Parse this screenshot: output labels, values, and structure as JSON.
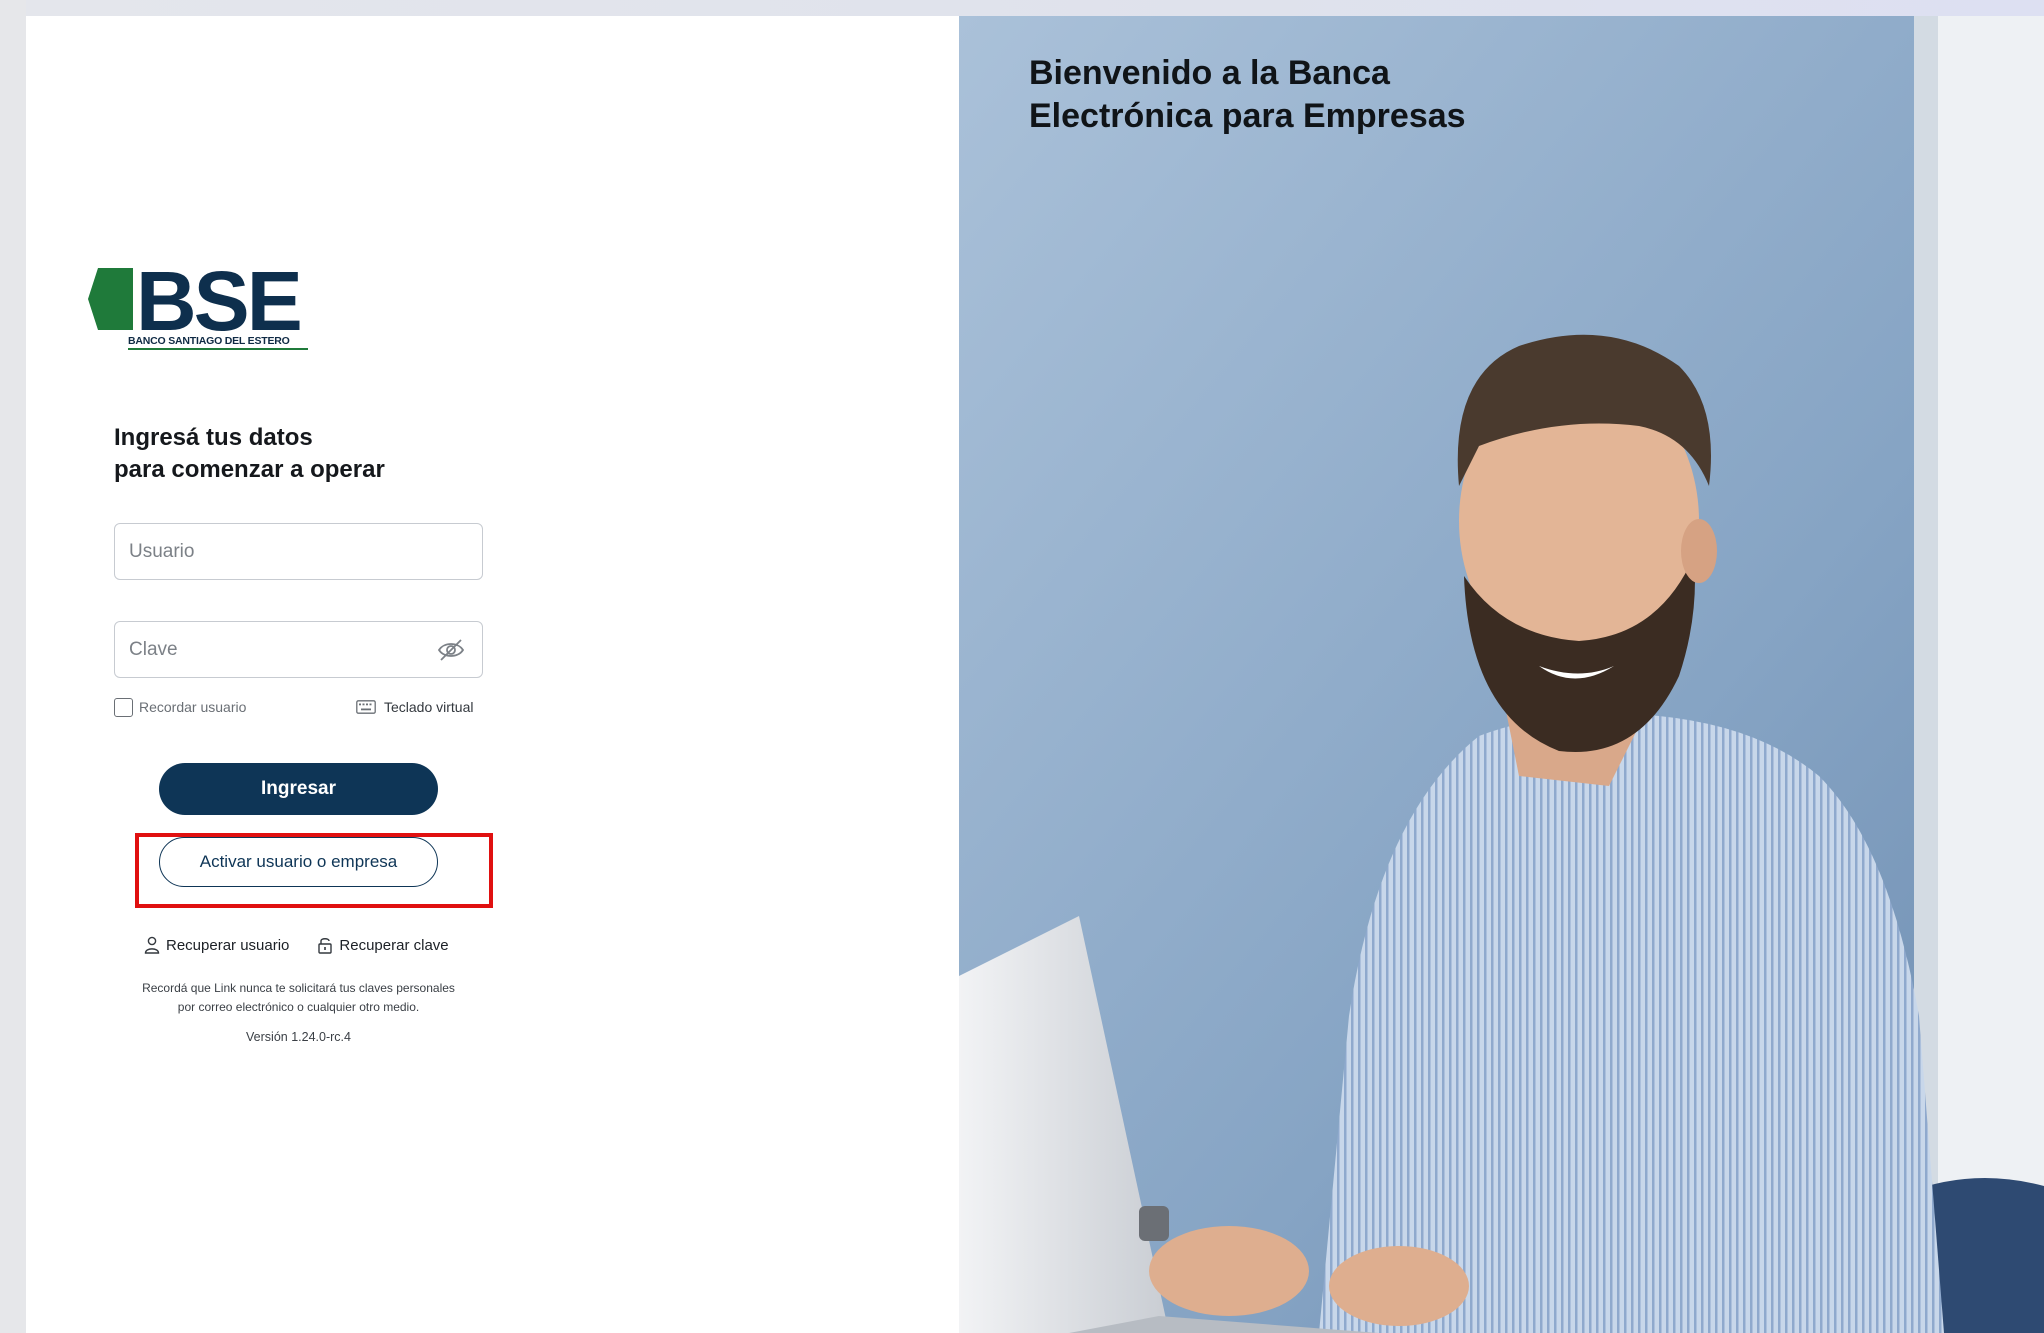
{
  "hero": {
    "title_line1": "Bienvenido a la Banca",
    "title_line2": "Electrónica para Empresas",
    "image": "man-smiling-working-on-laptop-photo"
  },
  "brand": {
    "logo_text": "BSE",
    "logo_caption": "BANCO SANTIAGO DEL ESTERO",
    "primary_color": "#0e3556",
    "accent_green": "#1f7a3a",
    "highlight_color": "#e01010"
  },
  "form": {
    "headline_line1": "Ingresá tus datos",
    "headline_line2": "para comenzar a operar",
    "user_placeholder": "Usuario",
    "password_placeholder": "Clave",
    "remember_label": "Recordar usuario",
    "remember_checked": false,
    "virtual_keyboard_label": "Teclado virtual",
    "submit_label": "Ingresar",
    "activate_label": "Activar usuario o empresa"
  },
  "links": {
    "recover_user": "Recuperar usuario",
    "recover_password": "Recuperar clave"
  },
  "footer": {
    "notice_line1": "Recordá que Link nunca te solicitará tus claves personales",
    "notice_line2": "por correo electrónico o cualquier otro medio.",
    "version": "Versión 1.24.0-rc.4"
  },
  "icons": {
    "password_toggle": "eye-slash-icon",
    "keyboard": "keyboard-icon",
    "user": "user-icon",
    "lock": "lock-icon"
  }
}
